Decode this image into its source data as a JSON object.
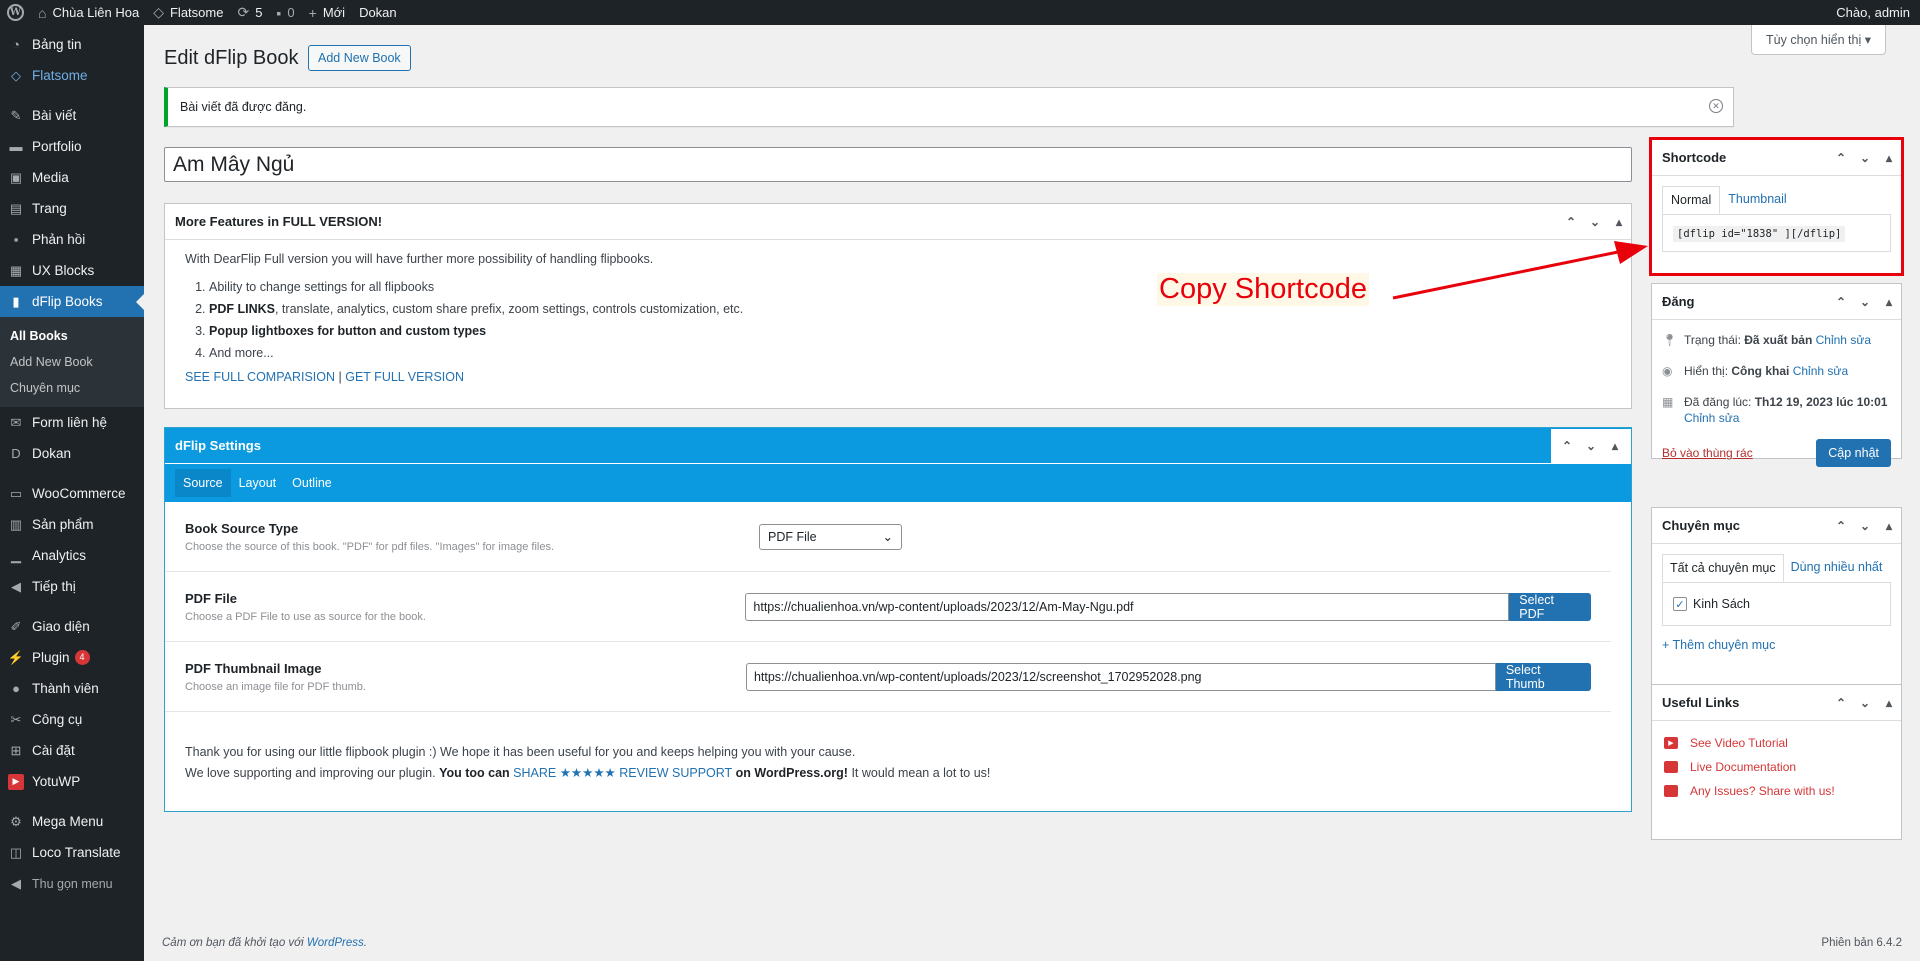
{
  "adminbar": {
    "site_name": "Chùa Liên Hoa",
    "theme": "Flatsome",
    "updates": "5",
    "comments": "0",
    "new_label": "Mới",
    "dokan": "Dokan",
    "greeting": "Chào, admin"
  },
  "sidebar": {
    "items": [
      {
        "label": "Bảng tin",
        "icon": "dashboard-icon"
      },
      {
        "label": "Flatsome",
        "icon": "flatsome-icon"
      },
      {
        "label": "Bài viết",
        "icon": "pin-icon"
      },
      {
        "label": "Portfolio",
        "icon": "folder-icon"
      },
      {
        "label": "Media",
        "icon": "media-icon"
      },
      {
        "label": "Trang",
        "icon": "page-icon"
      },
      {
        "label": "Phản hồi",
        "icon": "comment-icon"
      },
      {
        "label": "UX Blocks",
        "icon": "blocks-icon"
      },
      {
        "label": "dFlip Books",
        "icon": "book-icon"
      },
      {
        "label": "Form liên hệ",
        "icon": "mail-icon"
      },
      {
        "label": "Dokan",
        "icon": "dokan-icon"
      },
      {
        "label": "WooCommerce",
        "icon": "woo-icon"
      },
      {
        "label": "Sản phẩm",
        "icon": "archive-icon"
      },
      {
        "label": "Analytics",
        "icon": "chart-icon"
      },
      {
        "label": "Tiếp thị",
        "icon": "megaphone-icon"
      },
      {
        "label": "Giao diện",
        "icon": "brush-icon"
      },
      {
        "label": "Plugin",
        "icon": "plugin-icon",
        "badge": "4"
      },
      {
        "label": "Thành viên",
        "icon": "user-icon"
      },
      {
        "label": "Công cụ",
        "icon": "wrench-icon"
      },
      {
        "label": "Cài đặt",
        "icon": "settings-icon"
      },
      {
        "label": "YotuWP",
        "icon": "youtube-icon"
      },
      {
        "label": "Mega Menu",
        "icon": "gear-icon"
      },
      {
        "label": "Loco Translate",
        "icon": "translate-icon"
      },
      {
        "label": "Thu gọn menu",
        "icon": "collapse-icon"
      }
    ],
    "submenu": [
      "All Books",
      "Add New Book",
      "Chuyên mục"
    ]
  },
  "header": {
    "title": "Edit dFlip Book",
    "add_new": "Add New Book",
    "screen_options": "Tùy chọn hiển thị"
  },
  "notice": {
    "text": "Bài viết đã được đăng."
  },
  "post_title": "Am Mây Ngủ",
  "features": {
    "title": "More Features in FULL VERSION!",
    "intro": "With DearFlip Full version you will have further more possibility of handling flipbooks.",
    "items": [
      {
        "bold": "",
        "text": "Ability to change settings for all flipbooks"
      },
      {
        "bold": "PDF LINKS",
        "text": ", translate, analytics, custom share prefix, zoom settings, controls customization, etc."
      },
      {
        "bold": "Popup lightboxes for button and custom types",
        "text": ""
      },
      {
        "bold": "",
        "text": "And more..."
      }
    ],
    "link1": "SEE FULL COMPARISION",
    "sep": " | ",
    "link2": "GET FULL VERSION"
  },
  "settings": {
    "title": "dFlip Settings",
    "tabs": [
      "Source",
      "Layout",
      "Outline"
    ],
    "rows": [
      {
        "label": "Book Source Type",
        "desc": "Choose the source of this book. \"PDF\" for pdf files. \"Images\" for image files.",
        "value": "PDF File"
      },
      {
        "label": "PDF File",
        "desc": "Choose a PDF File to use as source for the book.",
        "value": "https://chualienhoa.vn/wp-content/uploads/2023/12/Am-May-Ngu.pdf",
        "button": "Select PDF"
      },
      {
        "label": "PDF Thumbnail Image",
        "desc": "Choose an image file for PDF thumb.",
        "value": "https://chualienhoa.vn/wp-content/uploads/2023/12/screenshot_1702952028.png",
        "button": "Select Thumb"
      }
    ],
    "thanks1": "Thank you for using our little flipbook plugin :) We hope it has been useful for you and keeps helping you with your cause.",
    "thanks2_a": "We love supporting and improving our plugin. ",
    "thanks2_b": "You too can ",
    "thanks2_link": "SHARE ★★★★★ REVIEW SUPPORT",
    "thanks2_c": " on WordPress.org!",
    "thanks2_d": " It would mean a lot to us!"
  },
  "shortcode": {
    "title": "Shortcode",
    "tabs": [
      "Normal",
      "Thumbnail"
    ],
    "code": "[dflip id=\"1838\" ][/dflip]"
  },
  "annotation": {
    "text": "Copy Shortcode",
    "color": "#e8000b"
  },
  "publish": {
    "title": "Đăng",
    "status_label": "Trạng thái: ",
    "status_value": "Đã xuất bản",
    "visibility_label": "Hiển thị: ",
    "visibility_value": "Công khai",
    "date_label": "Đã đăng lúc: ",
    "date_value": "Th12 19, 2023 lúc 10:01",
    "edit": "Chỉnh sửa",
    "trash": "Bỏ vào thùng rác",
    "update": "Cập nhật"
  },
  "categories": {
    "title": "Chuyên mục",
    "tabs": [
      "Tất cả chuyên mục",
      "Dùng nhiều nhất"
    ],
    "item": "Kinh Sách",
    "add": "+ Thêm chuyên mục"
  },
  "useful_links": {
    "title": "Useful Links",
    "links": [
      "See Video Tutorial",
      "Live Documentation",
      "Any Issues? Share with us!"
    ]
  },
  "footer": {
    "left_text": "Cảm ơn bạn đã khởi tạo với ",
    "left_link": "WordPress",
    "left_end": ".",
    "version": "Phiên bản 6.4.2"
  }
}
